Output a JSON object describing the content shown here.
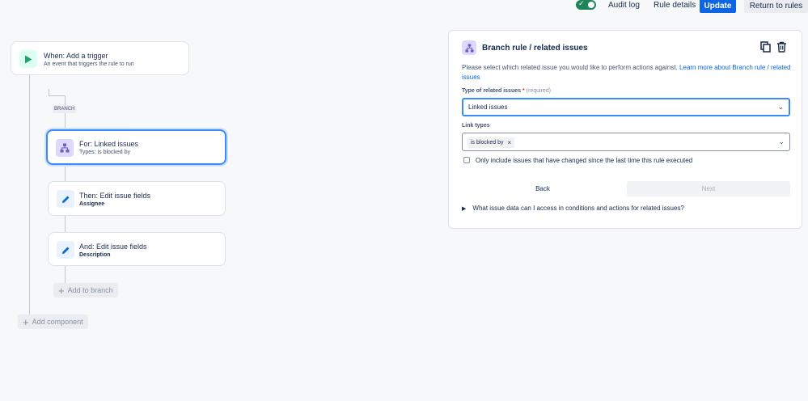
{
  "topbar": {
    "audit_log": "Audit log",
    "rule_details": "Rule details",
    "update": "Update",
    "return_to_rules": "Return to rules",
    "toggle_on": true
  },
  "flow": {
    "trigger": {
      "title": "When: Add a trigger",
      "subtitle": "An event that triggers the rule to run"
    },
    "branch_badge": "BRANCH",
    "branch_card": {
      "title": "For: Linked issues",
      "subtitle": "Types: is blocked by"
    },
    "action1": {
      "title": "Then: Edit issue fields",
      "subtitle": "Assignee"
    },
    "action2": {
      "title": "And: Edit issue fields",
      "subtitle": "Description"
    },
    "add_to_branch": "Add to branch",
    "add_component": "Add component"
  },
  "panel": {
    "title": "Branch rule / related issues",
    "desc_text": "Please select which related issue you would like to perform actions against.",
    "desc_link": "Learn more about Branch rule / related issues",
    "type_label": "Type of related issues",
    "type_required_mark": "*",
    "type_required_hint": "(required)",
    "type_value": "Linked issues",
    "link_types_label": "Link types",
    "link_types_chip": "is blocked by",
    "checkbox_label": "Only include issues that have changed since the last time this rule executed",
    "back": "Back",
    "next": "Next",
    "faq": "What issue data can I access in conditions and actions for related issues?"
  },
  "colors": {
    "primary": "#0c66e4",
    "toggle": "#1f845a",
    "trigger_icon_bg": "#dcfff1",
    "trigger_icon": "#22a06b",
    "branch_icon_bg": "#dfd8fd",
    "branch_icon": "#6e5dc6",
    "action_icon_bg": "#e9f2ff",
    "action_icon": "#0c66e4"
  }
}
